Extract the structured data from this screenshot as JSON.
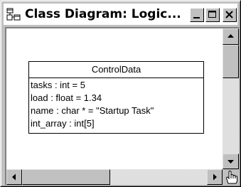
{
  "window": {
    "title": "Class Diagram: Logic...",
    "icon": "class-diagram-icon",
    "caption_buttons": [
      "minimize-icon",
      "maximize-icon",
      "close-icon"
    ]
  },
  "diagram": {
    "class_name": "ControlData",
    "attributes": [
      "tasks : int = 5",
      "load : float = 1.34",
      "name : char * = \"Startup Task\"",
      "int_array : int[5]"
    ]
  },
  "scrollbars": {
    "vertical": {
      "up_icon": "arrow-up-icon",
      "down_icon": "arrow-down-icon"
    },
    "horizontal": {
      "left_icon": "arrow-left-icon",
      "right_icon": "arrow-right-icon"
    }
  },
  "cursor": {
    "icon": "hand-cursor-icon"
  },
  "colors": {
    "chrome": "#c0c0c0",
    "canvas": "#ffffff",
    "text": "#000000"
  }
}
